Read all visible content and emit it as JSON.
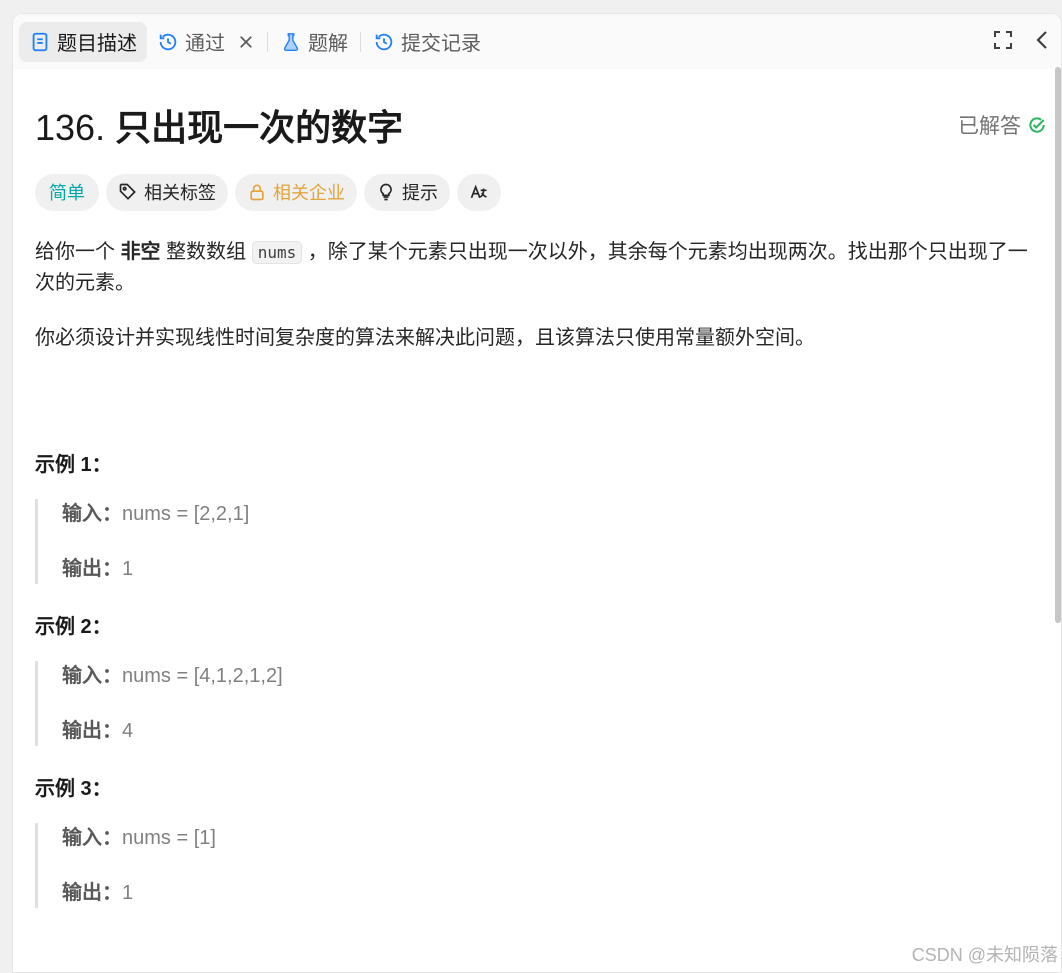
{
  "tabs": {
    "description": "题目描述",
    "submission_result": "通过",
    "solutions": "题解",
    "submissions": "提交记录"
  },
  "problem": {
    "number": "136.",
    "title": "只出现一次的数字",
    "status": "已解答",
    "tags": {
      "difficulty": "简单",
      "related_tags": "相关标签",
      "related_companies": "相关企业",
      "hint": "提示",
      "translate": "Aあ"
    },
    "desc_part1": "给你一个 ",
    "desc_bold": "非空",
    "desc_part2": " 整数数组 ",
    "desc_code": "nums",
    "desc_part3": " ，除了某个元素只出现一次以外，其余每个元素均出现两次。找出那个只出现了一次的元素。",
    "requirement": "你必须设计并实现线性时间复杂度的算法来解决此问题，且该算法只使用常量额外空间。"
  },
  "examples": [
    {
      "title": "示例 1：",
      "input_label": "输入：",
      "input": "nums = [2,2,1]",
      "output_label": "输出：",
      "output": "1"
    },
    {
      "title": "示例 2：",
      "input_label": "输入：",
      "input": "nums = [4,1,2,1,2]",
      "output_label": "输出：",
      "output": "4"
    },
    {
      "title": "示例 3：",
      "input_label": "输入：",
      "input": "nums = [1]",
      "output_label": "输出：",
      "output": "1"
    }
  ],
  "watermark": "CSDN @未知陨落",
  "colors": {
    "accent_blue": "#1e80ff",
    "success_green": "#2db55d",
    "easy_teal": "#00a8a8",
    "company_orange": "#e4a43b"
  }
}
